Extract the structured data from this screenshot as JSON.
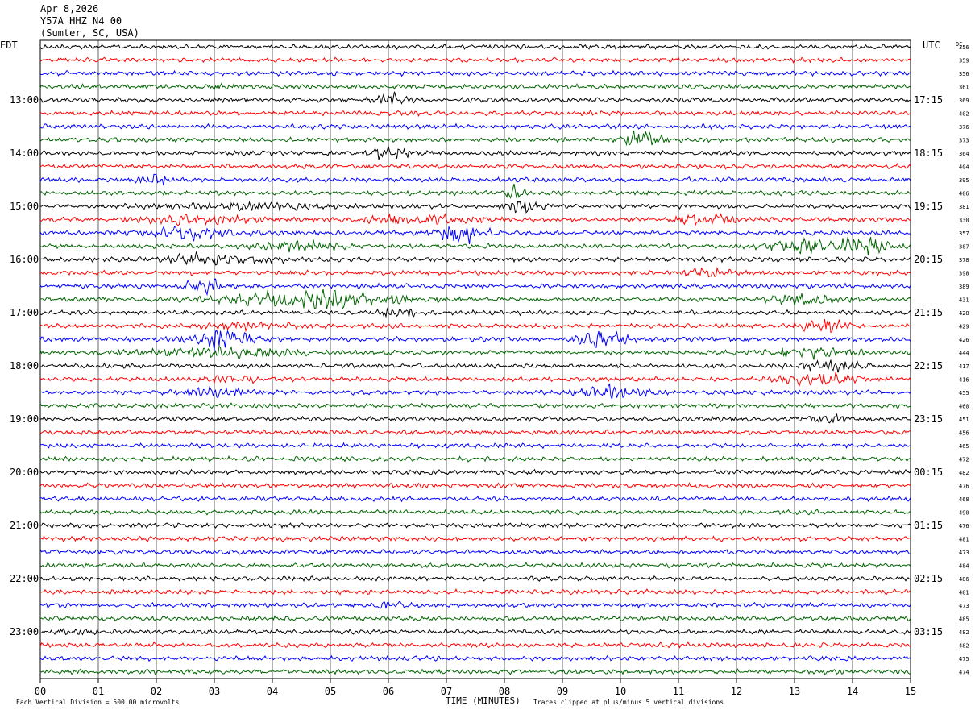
{
  "header": {
    "date": "Apr 8,2026",
    "station": "Y57A HHZ N4 00",
    "location": "(Sumter, SC, USA)"
  },
  "labels": {
    "left_tz": "EDT",
    "right_tz": "UTC",
    "dc_header": "DC",
    "x_axis": "TIME (MINUTES)",
    "scale_note": "Each Vertical Division =  500.00 microvolts",
    "clip_note": "Traces clipped at plus/minus 5 vertical divisions"
  },
  "chart_data": {
    "type": "line",
    "x_ticks": [
      "00",
      "01",
      "02",
      "03",
      "04",
      "05",
      "06",
      "07",
      "08",
      "09",
      "10",
      "11",
      "12",
      "13",
      "14",
      "15"
    ],
    "xlim": [
      0,
      15
    ],
    "edt_hours": [
      "13:00",
      "14:00",
      "15:00",
      "16:00",
      "17:00",
      "18:00",
      "19:00",
      "20:00",
      "21:00",
      "22:00",
      "23:00"
    ],
    "utc_hours": [
      "17:15",
      "18:15",
      "19:15",
      "20:15",
      "21:15",
      "22:15",
      "23:15",
      "00:15",
      "01:15",
      "02:15",
      "03:15"
    ],
    "trace_colors": [
      "#000000",
      "#ff0000",
      "#0000ff",
      "#006400"
    ],
    "dc_offsets": [
      356,
      359,
      356,
      361,
      369,
      402,
      376,
      373,
      364,
      404,
      395,
      406,
      381,
      330,
      357,
      387,
      378,
      398,
      389,
      431,
      428,
      429,
      426,
      444,
      417,
      416,
      455,
      460,
      451,
      456,
      465,
      472,
      482,
      476,
      468,
      490,
      476,
      481,
      473,
      484,
      486,
      481,
      473,
      485,
      482,
      482,
      475,
      474
    ],
    "bursts": [
      {
        "trace": 3,
        "minute": 3.05,
        "width": 0.12,
        "amp": 1.4
      },
      {
        "trace": 4,
        "minute": 6.0,
        "width": 0.25,
        "amp": 2.5
      },
      {
        "trace": 7,
        "minute": 10.35,
        "width": 0.3,
        "amp": 3.5
      },
      {
        "trace": 8,
        "minute": 6.0,
        "width": 0.35,
        "amp": 2.6
      },
      {
        "trace": 10,
        "minute": 2.0,
        "width": 0.3,
        "amp": 2.5
      },
      {
        "trace": 11,
        "minute": 8.2,
        "width": 0.2,
        "amp": 2.5
      },
      {
        "trace": 12,
        "minute": 8.3,
        "width": 0.3,
        "amp": 2.4
      },
      {
        "trace": 12,
        "minute": 3.5,
        "width": 1.2,
        "amp": 1.2
      },
      {
        "trace": 13,
        "minute": 2.7,
        "width": 0.9,
        "amp": 1.8
      },
      {
        "trace": 13,
        "minute": 6.5,
        "width": 1.0,
        "amp": 1.6
      },
      {
        "trace": 13,
        "minute": 11.5,
        "width": 0.5,
        "amp": 2.4
      },
      {
        "trace": 14,
        "minute": 2.6,
        "width": 0.7,
        "amp": 2.6
      },
      {
        "trace": 14,
        "minute": 7.2,
        "width": 0.45,
        "amp": 4.0
      },
      {
        "trace": 15,
        "minute": 4.5,
        "width": 0.6,
        "amp": 2.4
      },
      {
        "trace": 15,
        "minute": 13.2,
        "width": 0.8,
        "amp": 2.4
      },
      {
        "trace": 15,
        "minute": 14.2,
        "width": 0.5,
        "amp": 2.6
      },
      {
        "trace": 16,
        "minute": 3.0,
        "width": 1.0,
        "amp": 2.0
      },
      {
        "trace": 17,
        "minute": 11.5,
        "width": 0.4,
        "amp": 1.8
      },
      {
        "trace": 18,
        "minute": 2.8,
        "width": 0.3,
        "amp": 3.0
      },
      {
        "trace": 19,
        "minute": 4.8,
        "width": 1.5,
        "amp": 3.0
      },
      {
        "trace": 19,
        "minute": 13.2,
        "width": 0.6,
        "amp": 2.0
      },
      {
        "trace": 20,
        "minute": 6.2,
        "width": 0.3,
        "amp": 2.2
      },
      {
        "trace": 21,
        "minute": 3.5,
        "width": 0.8,
        "amp": 1.5
      },
      {
        "trace": 21,
        "minute": 13.5,
        "width": 0.35,
        "amp": 3.5
      },
      {
        "trace": 22,
        "minute": 3.1,
        "width": 0.5,
        "amp": 4.5
      },
      {
        "trace": 22,
        "minute": 9.7,
        "width": 0.35,
        "amp": 4.5
      },
      {
        "trace": 23,
        "minute": 3.0,
        "width": 1.4,
        "amp": 1.8
      },
      {
        "trace": 23,
        "minute": 13.3,
        "width": 0.8,
        "amp": 1.8
      },
      {
        "trace": 24,
        "minute": 13.6,
        "width": 0.5,
        "amp": 2.5
      },
      {
        "trace": 25,
        "minute": 3.3,
        "width": 0.4,
        "amp": 1.5
      },
      {
        "trace": 25,
        "minute": 13.4,
        "width": 0.6,
        "amp": 2.0
      },
      {
        "trace": 26,
        "minute": 9.9,
        "width": 0.5,
        "amp": 2.8
      },
      {
        "trace": 26,
        "minute": 3.0,
        "width": 0.5,
        "amp": 1.6
      },
      {
        "trace": 28,
        "minute": 13.6,
        "width": 0.3,
        "amp": 2.0
      },
      {
        "trace": 42,
        "minute": 6.0,
        "width": 0.3,
        "amp": 1.2
      },
      {
        "trace": 44,
        "minute": 0.5,
        "width": 0.35,
        "amp": 0.9
      }
    ]
  }
}
